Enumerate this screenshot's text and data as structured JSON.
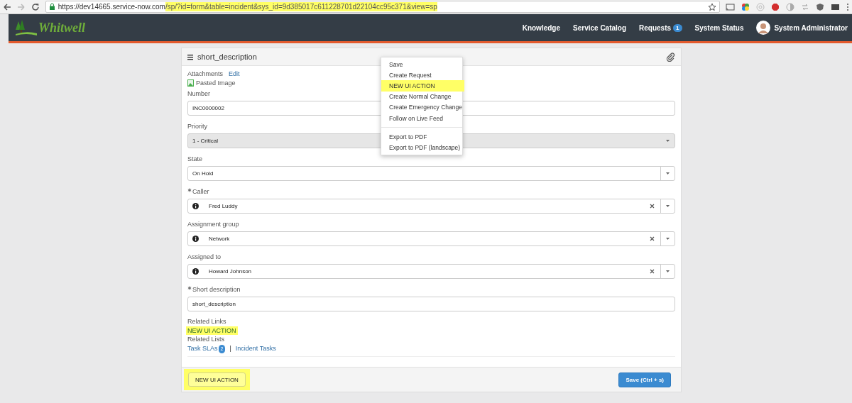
{
  "browser": {
    "url_base": "https://dev14665.service-now.com",
    "url_path": "/sp/?id=form&table=incident&sys_id=9d385017c611228701d22104cc95c371&view=sp",
    "url_path_highlighted": true
  },
  "header": {
    "logo": "Whitwell",
    "nav": [
      {
        "label": "Knowledge"
      },
      {
        "label": "Service Catalog"
      },
      {
        "label": "Requests",
        "badge": "1"
      },
      {
        "label": "System Status"
      }
    ],
    "user": "System Administrator"
  },
  "form": {
    "title": "short_description",
    "attachments_label": "Attachments",
    "edit_link": "Edit",
    "attachment": "Pasted Image",
    "fields": [
      {
        "label": "Number",
        "kind": "text",
        "value": "INC0000002",
        "required": false,
        "disabled": false
      },
      {
        "label": "Priority",
        "kind": "choice",
        "value": "1 - Critical",
        "required": false,
        "disabled": true
      },
      {
        "label": "State",
        "kind": "choice",
        "value": "On Hold",
        "required": false,
        "disabled": false
      },
      {
        "label": "Caller",
        "kind": "reference",
        "value": "Fred Luddy",
        "required": true,
        "disabled": false
      },
      {
        "label": "Assignment group",
        "kind": "reference",
        "value": "Network",
        "required": false,
        "disabled": false
      },
      {
        "label": "Assigned to",
        "kind": "reference",
        "value": "Howard Johnson",
        "required": false,
        "disabled": false
      },
      {
        "label": "Short description",
        "kind": "text",
        "value": "short_description",
        "required": true,
        "disabled": false
      }
    ],
    "related_links_label": "Related Links",
    "related_links": [
      {
        "label": "NEW UI ACTION",
        "highlighted": true
      }
    ],
    "related_lists_label": "Related Lists",
    "related_lists_separator": "|",
    "related_lists": [
      {
        "label": "Task SLAs",
        "badge": "2"
      },
      {
        "label": "Incident Tasks"
      }
    ],
    "buttons": [
      {
        "label": "NEW UI ACTION",
        "kind": "default",
        "highlighted": true
      },
      {
        "label": "Save (Ctrl + s)",
        "kind": "primary",
        "highlighted": false
      }
    ]
  },
  "menu": {
    "groups": [
      [
        {
          "label": "Save",
          "highlighted": false
        },
        {
          "label": "Create Request",
          "highlighted": false
        },
        {
          "label": "NEW UI ACTION",
          "highlighted": true
        },
        {
          "label": "Create Normal Change",
          "highlighted": false
        },
        {
          "label": "Create Emergency Change",
          "highlighted": false
        },
        {
          "label": "Follow on Live Feed",
          "highlighted": false
        }
      ],
      [
        {
          "label": "Export to PDF",
          "highlighted": false
        },
        {
          "label": "Export to PDF (landscape)",
          "highlighted": false
        }
      ]
    ]
  }
}
